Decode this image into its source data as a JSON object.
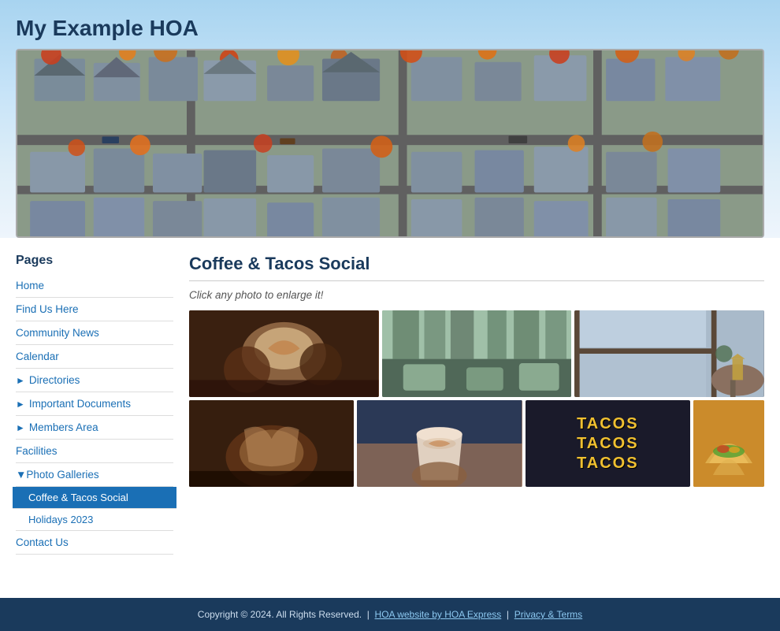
{
  "site": {
    "title": "My Example HOA"
  },
  "sidebar": {
    "section_label": "Pages",
    "items": [
      {
        "id": "home",
        "label": "Home",
        "type": "link"
      },
      {
        "id": "find-us-here",
        "label": "Find Us Here",
        "type": "link"
      },
      {
        "id": "community-news",
        "label": "Community News",
        "type": "link"
      },
      {
        "id": "calendar",
        "label": "Calendar",
        "type": "link"
      },
      {
        "id": "directories",
        "label": "Directories",
        "type": "expandable"
      },
      {
        "id": "important-documents",
        "label": "Important Documents",
        "type": "expandable"
      },
      {
        "id": "members-area",
        "label": "Members Area",
        "type": "expandable"
      },
      {
        "id": "facilities",
        "label": "Facilities",
        "type": "link"
      },
      {
        "id": "photo-galleries",
        "label": "Photo Galleries",
        "type": "section-open"
      },
      {
        "id": "coffee-tacos-social",
        "label": "Coffee & Tacos Social",
        "type": "sub-active"
      },
      {
        "id": "holidays-2023",
        "label": "Holidays 2023",
        "type": "sub"
      },
      {
        "id": "contact-us",
        "label": "Contact Us",
        "type": "link"
      }
    ]
  },
  "content": {
    "title": "Coffee & Tacos Social",
    "instruction": "Click any photo to enlarge it!",
    "gallery_rows": [
      [
        {
          "id": "photo1",
          "alt": "Latte art hands",
          "style": "photo-latte-hands"
        },
        {
          "id": "photo2",
          "alt": "Cafe interior",
          "style": "photo-cafe-interior"
        },
        {
          "id": "photo3",
          "alt": "Window table",
          "style": "photo-window-table"
        }
      ],
      [
        {
          "id": "photo4",
          "alt": "Barista hands",
          "style": "photo-barista-hands"
        },
        {
          "id": "photo5",
          "alt": "Latte cup",
          "style": "photo-latte-cup"
        },
        {
          "id": "photo6",
          "alt": "Tacos sign",
          "style": "photo-tacos-sign",
          "special": "tacos-text"
        },
        {
          "id": "photo7",
          "alt": "Taco food",
          "style": "photo-taco-food"
        }
      ]
    ]
  },
  "footer": {
    "copyright": "Copyright © 2024. All Rights Reserved.",
    "hoa_link_label": "HOA website by HOA Express",
    "privacy_label": "Privacy & Terms",
    "separator": "|"
  }
}
